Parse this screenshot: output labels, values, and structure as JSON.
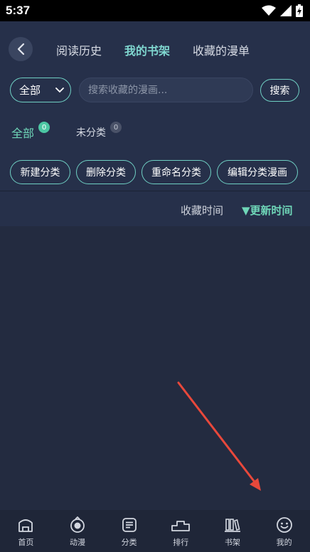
{
  "status_bar": {
    "time": "5:37"
  },
  "header": {
    "tabs": [
      {
        "label": "阅读历史",
        "active": false
      },
      {
        "label": "我的书架",
        "active": true
      },
      {
        "label": "收藏的漫单",
        "active": false
      }
    ]
  },
  "search": {
    "filter_value": "全部",
    "placeholder": "搜索收藏的漫画...",
    "value": "",
    "button_label": "搜索"
  },
  "categories": [
    {
      "label": "全部",
      "count": "0",
      "active": true
    },
    {
      "label": "未分类",
      "count": "0",
      "active": false
    }
  ],
  "actions": [
    "新建分类",
    "删除分类",
    "重命名分类",
    "编辑分类漫画"
  ],
  "sort": {
    "options": [
      {
        "label": "收藏时间",
        "active": false
      },
      {
        "label": "▼更新时间",
        "active": true
      }
    ]
  },
  "bottom_nav": [
    {
      "label": "首页",
      "icon": "home-icon"
    },
    {
      "label": "动漫",
      "icon": "anime-icon"
    },
    {
      "label": "分类",
      "icon": "category-icon"
    },
    {
      "label": "排行",
      "icon": "ranking-icon"
    },
    {
      "label": "书架",
      "icon": "bookshelf-icon"
    },
    {
      "label": "我的",
      "icon": "smiley-icon"
    }
  ],
  "colors": {
    "accent": "#6fcfc3",
    "background": "#232b40",
    "header_bg": "#26304a",
    "annotation_arrow": "#e8483b"
  }
}
